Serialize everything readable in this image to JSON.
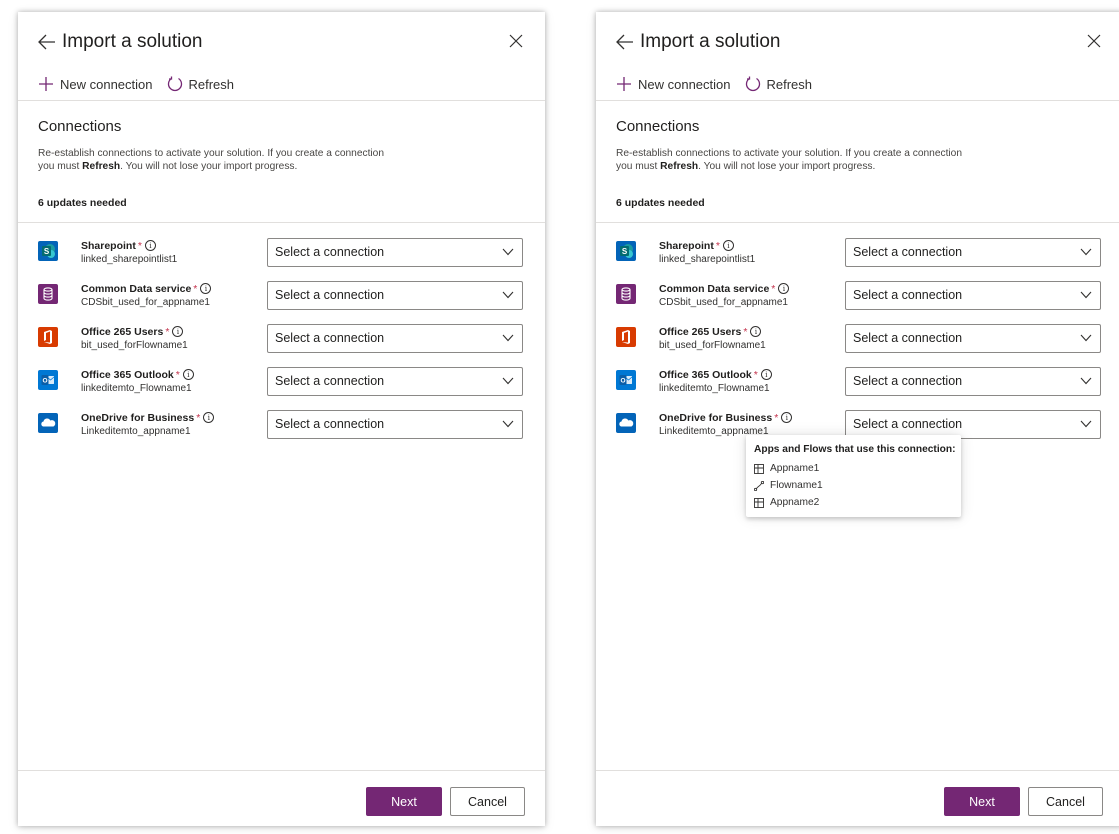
{
  "panels": [
    {
      "title": "Import a solution",
      "toolbar": {
        "new_connection": "New connection",
        "refresh": "Refresh"
      },
      "section_title": "Connections",
      "description_pre": "Re-establish connections to activate your solution. If you create a connection",
      "description_mid": "you must ",
      "description_bold": "Refresh",
      "description_post": ". You will not lose your import progress.",
      "updates_needed": "6 updates needed",
      "connections": [
        {
          "name": "Sharepoint",
          "sub": "linked_sharepointlist1",
          "placeholder": "Select a connection"
        },
        {
          "name": "Common Data service",
          "sub": "CDSbit_used_for_appname1",
          "placeholder": "Select a connection"
        },
        {
          "name": "Office 265 Users",
          "sub": "bit_used_forFlowname1",
          "placeholder": "Select a connection"
        },
        {
          "name": "Office 365 Outlook",
          "sub": "linkeditemto_Flowname1",
          "placeholder": "Select a connection"
        },
        {
          "name": "OneDrive for Business",
          "sub": "Linkeditemto_appname1",
          "placeholder": "Select a connection"
        }
      ],
      "required_marker": "*",
      "info_glyph": "i",
      "next_label": "Next",
      "cancel_label": "Cancel"
    },
    {
      "title": "Import a solution",
      "toolbar": {
        "new_connection": "New connection",
        "refresh": "Refresh"
      },
      "section_title": "Connections",
      "description_pre": "Re-establish connections to activate your solution. If you create a connection",
      "description_mid": "you must ",
      "description_bold": "Refresh",
      "description_post": ". You will not lose your import progress.",
      "updates_needed": "6 updates needed",
      "connections": [
        {
          "name": "Sharepoint",
          "sub": "linked_sharepointlist1",
          "placeholder": "Select a connection"
        },
        {
          "name": "Common Data service",
          "sub": "CDSbit_used_for_appname1",
          "placeholder": "Select a connection"
        },
        {
          "name": "Office 265 Users",
          "sub": "bit_used_forFlowname1",
          "placeholder": "Select a connection"
        },
        {
          "name": "Office 365 Outlook",
          "sub": "linkeditemto_Flowname1",
          "placeholder": "Select a connection"
        },
        {
          "name": "OneDrive for Business",
          "sub": "Linkeditemto_appname1",
          "placeholder": "Select a connection"
        }
      ],
      "required_marker": "*",
      "info_glyph": "i",
      "next_label": "Next",
      "cancel_label": "Cancel",
      "callout": {
        "title": "Apps and Flows that use this connection:",
        "items": [
          {
            "icon": "app-icon",
            "label": "Appname1"
          },
          {
            "icon": "flow-icon",
            "label": "Flowname1"
          },
          {
            "icon": "app-icon",
            "label": "Appname2"
          }
        ]
      }
    }
  ],
  "icons": {
    "sharepoint": {
      "name": "sharepoint-icon",
      "color": "#0364b8",
      "glyph": "S"
    },
    "dataverse": {
      "name": "database-icon",
      "color": "#742774"
    },
    "office": {
      "name": "office-icon",
      "color": "#d83b01"
    },
    "outlook": {
      "name": "outlook-icon",
      "color": "#0078d4",
      "glyph": "O"
    },
    "onedrive": {
      "name": "onedrive-icon",
      "color": "#0364b8"
    }
  },
  "colors": {
    "accent": "#742774",
    "required": "#c4314b",
    "border": "#8a8886"
  }
}
